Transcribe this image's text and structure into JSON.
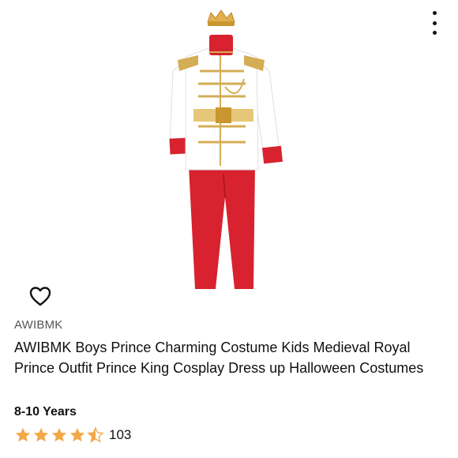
{
  "product": {
    "brand": "AWIBMK",
    "title": "AWIBMK Boys Prince Charming Costume Kids Medieval Royal Prince Outfit Prince King Cosplay Dress up Halloween Costumes",
    "size": "8-10 Years",
    "rating": 4.5,
    "rating_count": "103"
  },
  "icons": {
    "menu": "more-vertical-icon",
    "wishlist": "heart-outline-icon",
    "star": "star-icon"
  },
  "colors": {
    "star": "#f3a847",
    "costume_red": "#d8222f",
    "gold": "#d4ad55"
  }
}
